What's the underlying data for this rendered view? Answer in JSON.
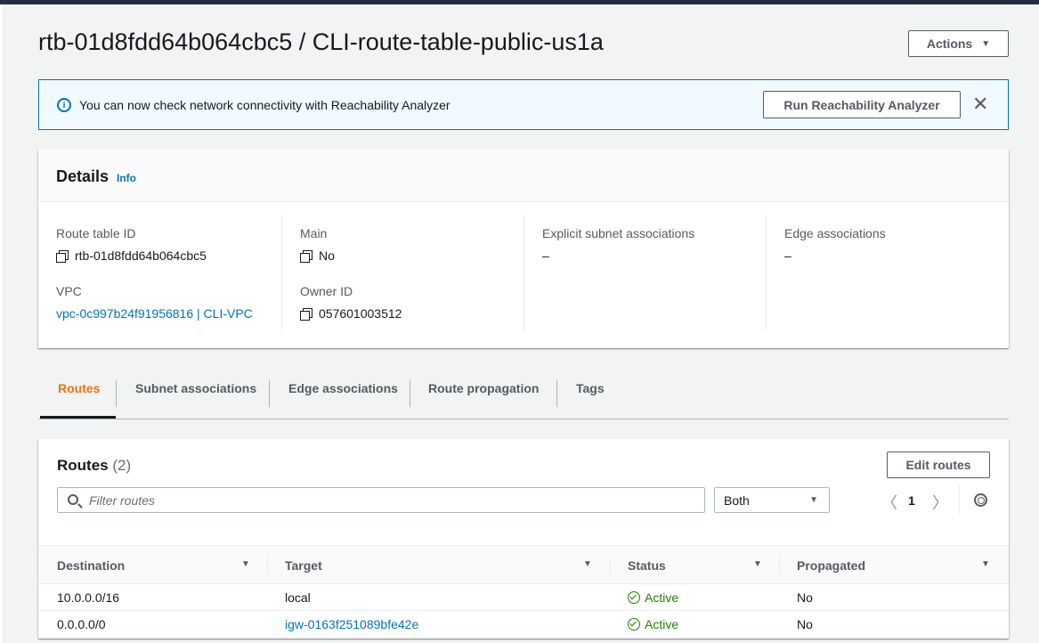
{
  "header": {
    "title": "rtb-01d8fdd64b064cbc5 / CLI-route-table-public-us1a",
    "actions_label": "Actions"
  },
  "banner": {
    "message": "You can now check network connectivity with Reachability Analyzer",
    "button_label": "Run Reachability Analyzer",
    "info_icon": "i",
    "close_glyph": "✕"
  },
  "details": {
    "title": "Details",
    "info_link": "Info",
    "fields": {
      "route_table_id": {
        "label": "Route table ID",
        "value": "rtb-01d8fdd64b064cbc5"
      },
      "main": {
        "label": "Main",
        "value": "No"
      },
      "explicit_subnet": {
        "label": "Explicit subnet associations",
        "value": "–"
      },
      "edge": {
        "label": "Edge associations",
        "value": "–"
      },
      "vpc": {
        "label": "VPC",
        "value": "vpc-0c997b24f91956816 | CLI-VPC"
      },
      "owner": {
        "label": "Owner ID",
        "value": "057601003512"
      }
    }
  },
  "tabs": [
    {
      "label": "Routes",
      "active": true
    },
    {
      "label": "Subnet associations",
      "active": false
    },
    {
      "label": "Edge associations",
      "active": false
    },
    {
      "label": "Route propagation",
      "active": false
    },
    {
      "label": "Tags",
      "active": false
    }
  ],
  "routes": {
    "title": "Routes",
    "count": "(2)",
    "edit_label": "Edit routes",
    "search_placeholder": "Filter routes",
    "filter_value": "Both",
    "page": "1",
    "columns": [
      "Destination",
      "Target",
      "Status",
      "Propagated"
    ],
    "rows": [
      {
        "destination": "10.0.0.0/16",
        "target": "local",
        "target_is_link": false,
        "status": "Active",
        "propagated": "No"
      },
      {
        "destination": "0.0.0.0/0",
        "target": "igw-0163f251089bfe42e",
        "target_is_link": true,
        "status": "Active",
        "propagated": "No"
      }
    ]
  },
  "colors": {
    "link": "#0073bb",
    "active_tab": "#ec7211",
    "status_ok": "#1d8102",
    "banner_bg": "#f1faff"
  }
}
